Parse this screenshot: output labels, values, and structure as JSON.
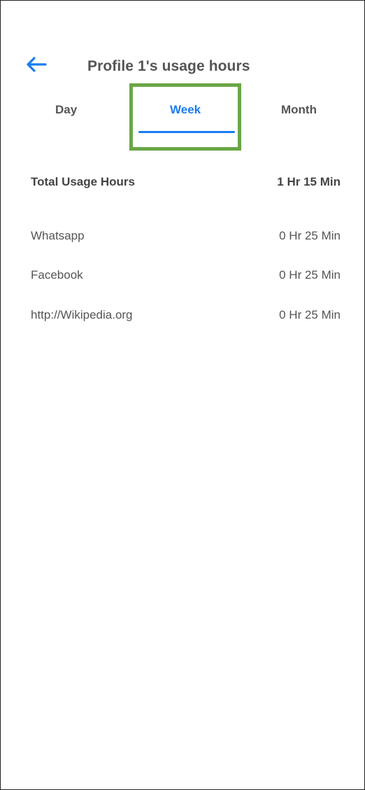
{
  "header": {
    "back_icon": "arrow-left-icon",
    "title": "Profile 1's usage hours",
    "accent_color": "#1a7cf0"
  },
  "tabs": [
    {
      "label": "Day",
      "selected": false
    },
    {
      "label": "Week",
      "selected": true
    },
    {
      "label": "Month",
      "selected": false
    }
  ],
  "highlight_color": "#6aa646",
  "total": {
    "label": "Total Usage Hours",
    "value": "1 Hr 15 Min"
  },
  "apps": [
    {
      "name": "Whatsapp",
      "usage": "0 Hr 25 Min"
    },
    {
      "name": "Facebook",
      "usage": "0 Hr 25 Min"
    },
    {
      "name": "http://Wikipedia.org",
      "usage": "0 Hr 25 Min"
    }
  ]
}
